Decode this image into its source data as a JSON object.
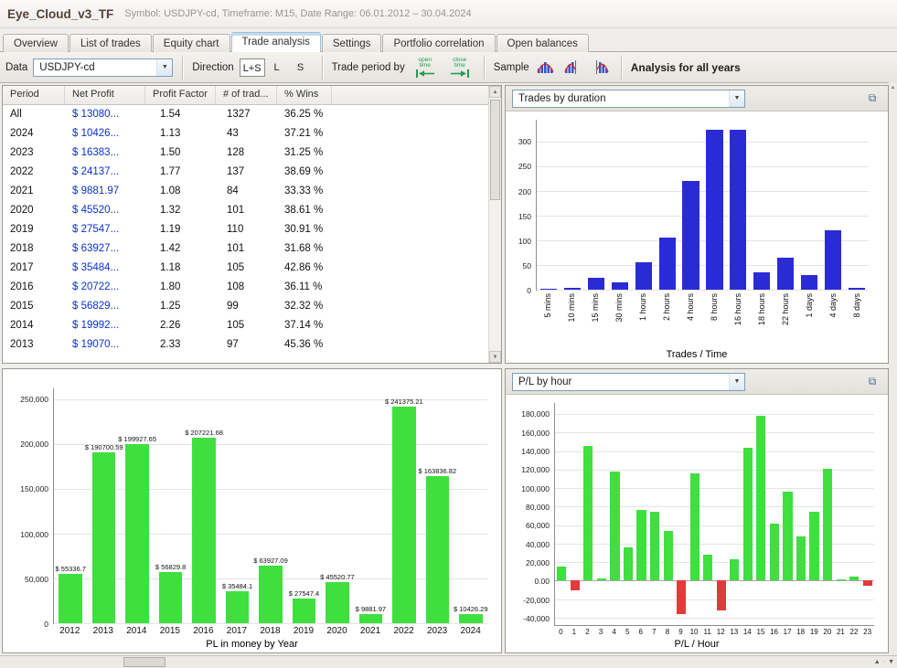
{
  "title_bar": {
    "app_title": "Eye_Cloud_v3_TF",
    "subtitle": "Symbol: USDJPY-cd, Timeframe: M15, Date Range: 06.01.2012 – 30.04.2024"
  },
  "tabs": [
    {
      "label": "Overview",
      "active": false
    },
    {
      "label": "List of trades",
      "active": false
    },
    {
      "label": "Equity chart",
      "active": false
    },
    {
      "label": "Trade analysis",
      "active": true
    },
    {
      "label": "Settings",
      "active": false
    },
    {
      "label": "Portfolio correlation",
      "active": false
    },
    {
      "label": "Open balances",
      "active": false
    }
  ],
  "toolbar": {
    "data_label": "Data",
    "data_value": "USDJPY-cd",
    "direction_label": "Direction",
    "direction_options": [
      "L+S",
      "L",
      "S"
    ],
    "direction_selected": "L+S",
    "trade_period_label": "Trade period by",
    "open_time_icon_label": "open time",
    "close_time_icon_label": "close time",
    "sample_label": "Sample",
    "analysis_title": "Analysis for all years"
  },
  "table": {
    "columns": [
      "Period",
      "Net Profit",
      "Profit Factor",
      "# of trad...",
      "% Wins"
    ],
    "rows": [
      [
        "All",
        "$ 13080...",
        "1.54",
        "1327",
        "36.25 %"
      ],
      [
        "2024",
        "$ 10426...",
        "1.13",
        "43",
        "37.21 %"
      ],
      [
        "2023",
        "$ 16383...",
        "1.50",
        "128",
        "31.25 %"
      ],
      [
        "2022",
        "$ 24137...",
        "1.77",
        "137",
        "38.69 %"
      ],
      [
        "2021",
        "$ 9881.97",
        "1.08",
        "84",
        "33.33 %"
      ],
      [
        "2020",
        "$ 45520...",
        "1.32",
        "101",
        "38.61 %"
      ],
      [
        "2019",
        "$ 27547...",
        "1.19",
        "110",
        "30.91 %"
      ],
      [
        "2018",
        "$ 63927...",
        "1.42",
        "101",
        "31.68 %"
      ],
      [
        "2017",
        "$ 35484...",
        "1.18",
        "105",
        "42.86 %"
      ],
      [
        "2016",
        "$ 20722...",
        "1.80",
        "108",
        "36.11 %"
      ],
      [
        "2015",
        "$ 56829...",
        "1.25",
        "99",
        "32.32 %"
      ],
      [
        "2014",
        "$ 19992...",
        "2.26",
        "105",
        "37.14 %"
      ],
      [
        "2013",
        "$ 19070...",
        "2.33",
        "97",
        "45.36 %"
      ]
    ]
  },
  "chart_data": [
    {
      "id": "trades_by_duration",
      "type": "bar",
      "title": "Trades by duration",
      "categories": [
        "5 mins",
        "10 mins",
        "15 mins",
        "30 mins",
        "1 hours",
        "2 hours",
        "4 hours",
        "8 hours",
        "16 hours",
        "18 hours",
        "22 hours",
        "1 days",
        "4 days",
        "8 days"
      ],
      "values": [
        2,
        3,
        25,
        15,
        55,
        105,
        220,
        325,
        325,
        35,
        65,
        30,
        120,
        3
      ],
      "xlabel": "Trades / Time",
      "ylabel": "",
      "ylim": [
        0,
        345
      ],
      "yticks": [
        0,
        50,
        100,
        150,
        200,
        250,
        300
      ],
      "ytick_labels": [
        "0",
        "50",
        "100",
        "150",
        "200",
        "250",
        "300"
      ],
      "grid": true,
      "bar_color": "#2b2bd6"
    },
    {
      "id": "pl_in_money_by_year",
      "type": "bar",
      "categories": [
        "2012",
        "2013",
        "2014",
        "2015",
        "2016",
        "2017",
        "2018",
        "2019",
        "2020",
        "2021",
        "2022",
        "2023",
        "2024"
      ],
      "values": [
        55336.7,
        190700.59,
        199927.65,
        56829.8,
        207221.68,
        35484.1,
        63927.09,
        27547.4,
        45520.77,
        9881.97,
        241375.21,
        163836.82,
        10426.29
      ],
      "bar_labels": [
        "$ 55336.7",
        "$ 190700.59",
        "$ 199927.65",
        "$ 56829.8",
        "$ 207221.68",
        "$ 35484.1",
        "$ 63927.09",
        "$ 27547.4",
        "$ 45520.77",
        "$ 9881.97",
        "$ 241375.21",
        "$ 163836.82",
        "$ 10426.29"
      ],
      "xlabel": "PL in money by Year",
      "ylabel": "",
      "ylim": [
        0,
        262000
      ],
      "yticks": [
        0,
        50000,
        100000,
        150000,
        200000,
        250000
      ],
      "ytick_labels": [
        "0",
        "50,000",
        "100,000",
        "150,000",
        "200,000",
        "250,000"
      ],
      "grid": true,
      "bar_color": "#3fdf3f"
    },
    {
      "id": "pl_by_hour",
      "type": "bar",
      "title": "P/L by hour",
      "categories": [
        "0",
        "1",
        "2",
        "3",
        "4",
        "5",
        "6",
        "7",
        "8",
        "9",
        "10",
        "11",
        "12",
        "13",
        "14",
        "15",
        "16",
        "17",
        "18",
        "19",
        "20",
        "21",
        "22",
        "23"
      ],
      "values": [
        15000,
        -10000,
        146000,
        2000,
        118000,
        36000,
        76000,
        74000,
        54000,
        -36000,
        116000,
        28000,
        -32000,
        23000,
        144000,
        178000,
        62000,
        96000,
        48000,
        74000,
        121000,
        1500,
        4000,
        -6000
      ],
      "xlabel": "P/L / Hour",
      "ylabel": "",
      "ylim": [
        -48000,
        192000
      ],
      "yticks": [
        -40000,
        -20000,
        0,
        20000,
        40000,
        60000,
        80000,
        100000,
        120000,
        140000,
        160000,
        180000
      ],
      "ytick_labels": [
        "-40,000",
        "-20,000",
        "0.00",
        "20,000",
        "40,000",
        "60,000",
        "80,000",
        "100,000",
        "120,000",
        "140,000",
        "160,000",
        "180,000"
      ],
      "grid": true,
      "positive_color": "#3fdf3f",
      "negative_color": "#e23b3b"
    }
  ]
}
